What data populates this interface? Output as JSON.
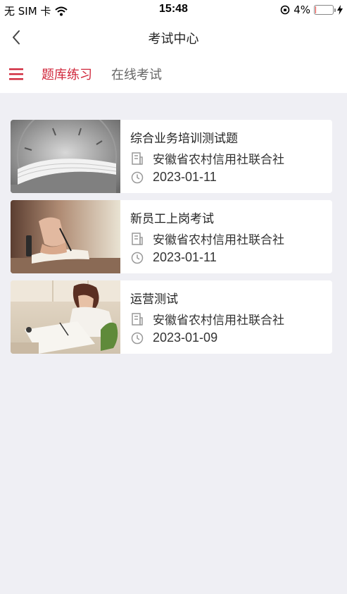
{
  "status_bar": {
    "carrier": "无 SIM 卡",
    "time": "15:48",
    "battery_percent": "4%",
    "battery_level": 0.04
  },
  "nav": {
    "title": "考试中心",
    "back_icon": "chevron-left-icon"
  },
  "tabs": {
    "menu_icon": "hamburger-menu-icon",
    "items": [
      {
        "label": "题库练习",
        "active": true
      },
      {
        "label": "在线考试",
        "active": false
      }
    ]
  },
  "colors": {
    "accent": "#d0283c",
    "background": "#efeff4"
  },
  "exams": [
    {
      "title": "综合业务培训测试题",
      "org": "安徽省农村信用社联合社",
      "date": "2023-01-11",
      "image": "clock-and-book-photo"
    },
    {
      "title": "新员工上岗考试",
      "org": "安徽省农村信用社联合社",
      "date": "2023-01-11",
      "image": "hand-writing-photo"
    },
    {
      "title": "运营测试",
      "org": "安徽省农村信用社联合社",
      "date": "2023-01-09",
      "image": "woman-drawing-photo"
    }
  ]
}
